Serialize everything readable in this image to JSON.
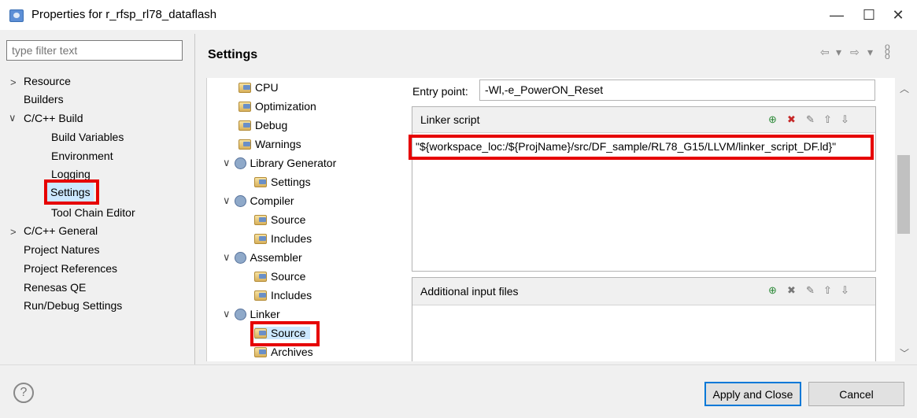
{
  "window": {
    "title": "Properties for r_rfsp_rl78_dataflash",
    "minimize": "—",
    "maximize": "☐",
    "close": "✕"
  },
  "filter": {
    "placeholder": "type filter text"
  },
  "left_tree": [
    {
      "label": "Resource",
      "expander": ">"
    },
    {
      "label": "Builders"
    },
    {
      "label": "C/C++ Build",
      "expander": "∨"
    },
    {
      "label": "Build Variables"
    },
    {
      "label": "Environment"
    },
    {
      "label": "Logging"
    },
    {
      "label": "Settings",
      "selected": true
    },
    {
      "label": "Tool Chain Editor"
    },
    {
      "label": "C/C++ General",
      "expander": ">"
    },
    {
      "label": "Project Natures"
    },
    {
      "label": "Project References"
    },
    {
      "label": "Renesas QE"
    },
    {
      "label": "Run/Debug Settings"
    }
  ],
  "settings": {
    "title": "Settings",
    "nav_back_icon": "⇦",
    "nav_forward_icon": "⇨",
    "menu_icon": "▾"
  },
  "tool_tree": [
    {
      "label": "CPU",
      "icon": "folder-settings-icon"
    },
    {
      "label": "Optimization",
      "icon": "folder-settings-icon"
    },
    {
      "label": "Debug",
      "icon": "folder-settings-icon"
    },
    {
      "label": "Warnings",
      "icon": "folder-settings-icon"
    },
    {
      "label": "Library Generator",
      "icon": "gear-icon",
      "expander": "∨"
    },
    {
      "label": "Settings",
      "icon": "folder-settings-icon"
    },
    {
      "label": "Compiler",
      "icon": "gear-icon",
      "expander": "∨"
    },
    {
      "label": "Source",
      "icon": "folder-settings-icon"
    },
    {
      "label": "Includes",
      "icon": "folder-settings-icon"
    },
    {
      "label": "Assembler",
      "icon": "gear-icon",
      "expander": "∨"
    },
    {
      "label": "Source",
      "icon": "folder-settings-icon"
    },
    {
      "label": "Includes",
      "icon": "folder-settings-icon"
    },
    {
      "label": "Linker",
      "icon": "gear-icon",
      "expander": "∨"
    },
    {
      "label": "Source",
      "icon": "folder-settings-icon",
      "selected": true
    },
    {
      "label": "Archives",
      "icon": "folder-settings-icon"
    }
  ],
  "linker": {
    "entry_point_label": "Entry point:",
    "entry_point_value": "-Wl,-e_PowerON_Reset",
    "linker_script_title": "Linker script",
    "linker_script_value": "\"${workspace_loc:/${ProjName}/src/DF_sample/RL78_G15/LLVM/linker_script_DF.ld}\"",
    "additional_files_title": "Additional input files"
  },
  "buttons": {
    "apply_close": "Apply and Close",
    "cancel": "Cancel",
    "help": "?"
  },
  "colors": {
    "highlight": "#e60000",
    "selection": "#cce8ff"
  }
}
